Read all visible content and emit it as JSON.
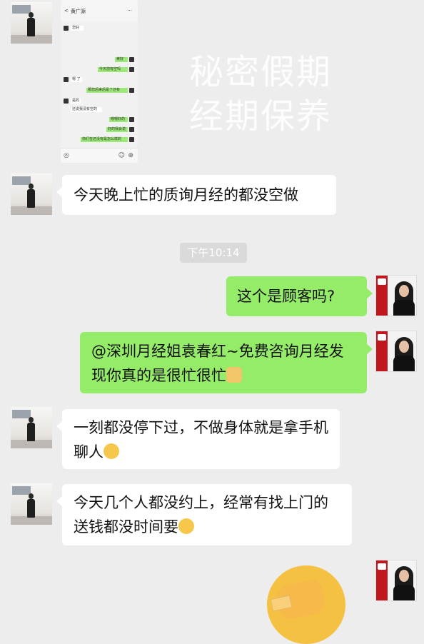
{
  "overlay": {
    "lines": [
      "秘密假期",
      "经期保养"
    ]
  },
  "screenshot": {
    "title": "黄广源",
    "back": "<",
    "more": "···",
    "rows": [
      {
        "side": "l",
        "text": "您好"
      },
      {
        "side": "r",
        "text": "美好"
      },
      {
        "side": "r",
        "text": "今天您有空吗"
      },
      {
        "side": "l",
        "text": "嗯 了"
      },
      {
        "side": "r",
        "text": "那您后来后是了还有"
      },
      {
        "side": "l",
        "text": "是的"
      },
      {
        "side": "l",
        "text": "还说我没有空的"
      },
      {
        "side": "r",
        "text": "嗯嗯好的"
      },
      {
        "side": "r",
        "text": "好的我会说"
      },
      {
        "side": "r",
        "text": "你们在还没有是怎么样的"
      }
    ],
    "bottom_icons": [
      "◎",
      "☺",
      "⊕"
    ]
  },
  "messages": [
    {
      "side": "left",
      "text": "今天晚上忙的质询月经的都没空做"
    },
    {
      "side": "right",
      "text": "这个是顾客吗?"
    },
    {
      "side": "right",
      "text": "@深圳月经姐袁春红~免费咨询月经发现你真的是很忙很忙",
      "emoji": "thumbs-up-icon"
    },
    {
      "side": "left",
      "text": "一刻都没停下过，不做身体就是拿手机聊人",
      "emoji": "thinking-face-icon"
    },
    {
      "side": "left",
      "text": "今天几个人都没约上，经常有找上门的送钱都没时间要",
      "emoji": "grimacing-face-icon"
    }
  ],
  "timestamp": "下午10:14",
  "colors": {
    "background": "#ededed",
    "green_bubble": "#95ec69",
    "white_bubble": "#ffffff",
    "brand_red": "#c0161d"
  },
  "last_message": {
    "side": "right",
    "sticker": "face-palm-sticker"
  }
}
